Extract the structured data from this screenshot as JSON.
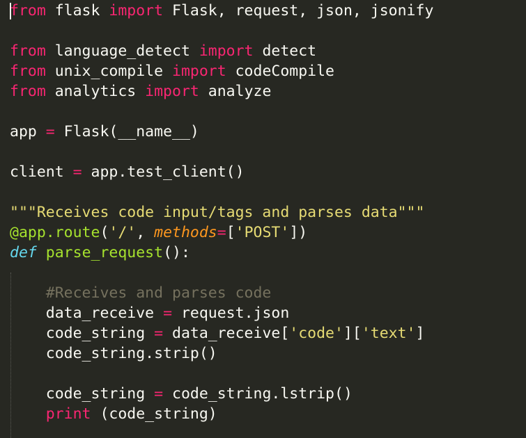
{
  "editor": {
    "theme_colors": {
      "background": "#272822",
      "text": "#f8f8f2",
      "keyword": "#f92672",
      "function": "#a6e22e",
      "string": "#e6db74",
      "comment": "#75715e",
      "def": "#66d9ef",
      "parameter": "#fd971f"
    },
    "lines": [
      {
        "tokens": [
          {
            "t": "from",
            "c": "kw"
          },
          {
            "t": " flask ",
            "c": "plain"
          },
          {
            "t": "import",
            "c": "kw"
          },
          {
            "t": " Flask, request, json, jsonify",
            "c": "plain"
          }
        ]
      },
      {
        "tokens": []
      },
      {
        "tokens": [
          {
            "t": "from",
            "c": "kw"
          },
          {
            "t": " language_detect ",
            "c": "plain"
          },
          {
            "t": "import",
            "c": "kw"
          },
          {
            "t": " detect",
            "c": "plain"
          }
        ]
      },
      {
        "tokens": [
          {
            "t": "from",
            "c": "kw"
          },
          {
            "t": " unix_compile ",
            "c": "plain"
          },
          {
            "t": "import",
            "c": "kw"
          },
          {
            "t": " codeCompile",
            "c": "plain"
          }
        ]
      },
      {
        "tokens": [
          {
            "t": "from",
            "c": "kw"
          },
          {
            "t": " analytics ",
            "c": "plain"
          },
          {
            "t": "import",
            "c": "kw"
          },
          {
            "t": " analyze",
            "c": "plain"
          }
        ]
      },
      {
        "tokens": []
      },
      {
        "tokens": [
          {
            "t": "app ",
            "c": "plain"
          },
          {
            "t": "=",
            "c": "op"
          },
          {
            "t": " Flask(__name__)",
            "c": "plain"
          }
        ]
      },
      {
        "tokens": []
      },
      {
        "tokens": [
          {
            "t": "client ",
            "c": "plain"
          },
          {
            "t": "=",
            "c": "op"
          },
          {
            "t": " app.test_client()",
            "c": "plain"
          }
        ]
      },
      {
        "tokens": []
      },
      {
        "tokens": [
          {
            "t": "\"\"\"Receives code input/tags and parses data\"\"\"",
            "c": "str"
          }
        ]
      },
      {
        "tokens": [
          {
            "t": "@app.route",
            "c": "fn"
          },
          {
            "t": "(",
            "c": "plain"
          },
          {
            "t": "'/'",
            "c": "str"
          },
          {
            "t": ", ",
            "c": "plain"
          },
          {
            "t": "methods",
            "c": "param"
          },
          {
            "t": "=",
            "c": "op"
          },
          {
            "t": "[",
            "c": "plain"
          },
          {
            "t": "'POST'",
            "c": "str"
          },
          {
            "t": "])",
            "c": "plain"
          }
        ]
      },
      {
        "tokens": [
          {
            "t": "def",
            "c": "df"
          },
          {
            "t": " ",
            "c": "plain"
          },
          {
            "t": "parse_request",
            "c": "fn"
          },
          {
            "t": "():",
            "c": "plain"
          }
        ]
      },
      {
        "tokens": []
      },
      {
        "tokens": [
          {
            "t": "    #Receives and parses code",
            "c": "cm"
          }
        ]
      },
      {
        "tokens": [
          {
            "t": "    data_receive ",
            "c": "plain"
          },
          {
            "t": "=",
            "c": "op"
          },
          {
            "t": " request.json",
            "c": "plain"
          }
        ]
      },
      {
        "tokens": [
          {
            "t": "    code_string ",
            "c": "plain"
          },
          {
            "t": "=",
            "c": "op"
          },
          {
            "t": " data_receive[",
            "c": "plain"
          },
          {
            "t": "'code'",
            "c": "str"
          },
          {
            "t": "][",
            "c": "plain"
          },
          {
            "t": "'text'",
            "c": "str"
          },
          {
            "t": "]",
            "c": "plain"
          }
        ]
      },
      {
        "tokens": [
          {
            "t": "    code_string.strip()",
            "c": "plain"
          }
        ]
      },
      {
        "tokens": []
      },
      {
        "tokens": [
          {
            "t": "    code_string ",
            "c": "plain"
          },
          {
            "t": "=",
            "c": "op"
          },
          {
            "t": " code_string.lstrip()",
            "c": "plain"
          }
        ]
      },
      {
        "tokens": [
          {
            "t": "    ",
            "c": "plain"
          },
          {
            "t": "print",
            "c": "kw"
          },
          {
            "t": " (code_string)",
            "c": "plain"
          }
        ]
      }
    ]
  }
}
